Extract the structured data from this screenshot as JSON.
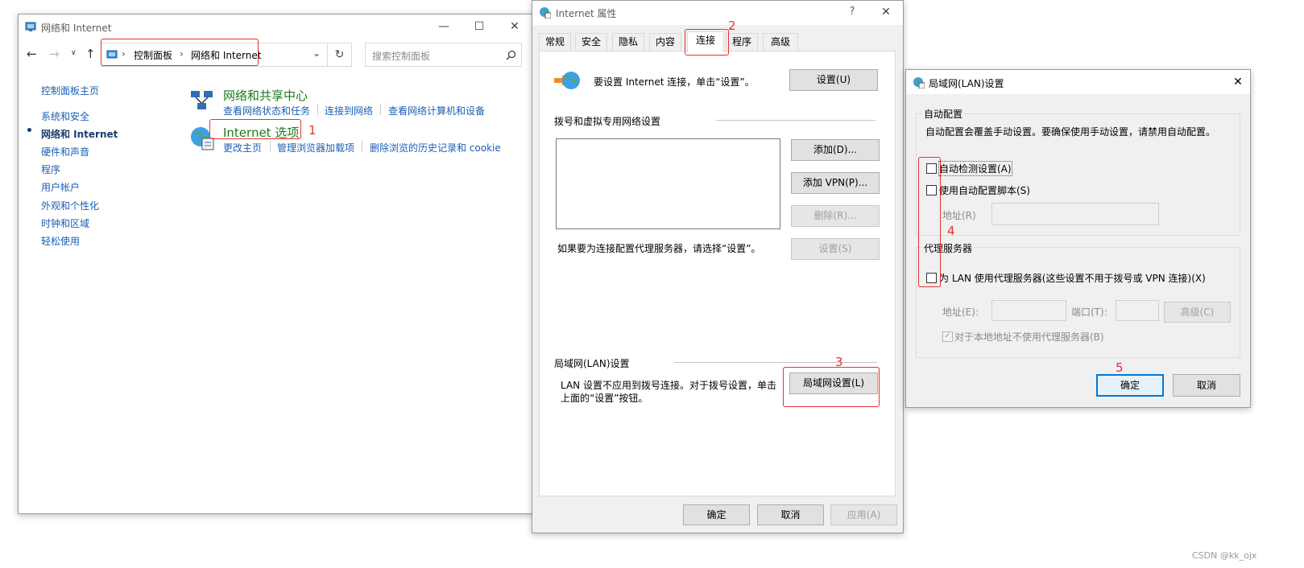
{
  "cp": {
    "title": "网络和 Internet",
    "breadcrumb": [
      "控制面板",
      "网络和 Internet"
    ],
    "search_placeholder": "搜索控制面板",
    "nav": [
      "控制面板主页",
      "系统和安全",
      "网络和 Internet",
      "硬件和声音",
      "程序",
      "用户帐户",
      "外观和个性化",
      "时钟和区域",
      "轻松使用"
    ],
    "sections": [
      {
        "title": "网络和共享中心",
        "links": [
          "查看网络状态和任务",
          "连接到网络",
          "查看网络计算机和设备"
        ]
      },
      {
        "title": "Internet 选项",
        "links": [
          "更改主页",
          "管理浏览器加载项",
          "删除浏览的历史记录和 cookie"
        ]
      }
    ]
  },
  "ip": {
    "title": "Internet 属性",
    "help": "?",
    "tabs": [
      "常规",
      "安全",
      "隐私",
      "内容",
      "连接",
      "程序",
      "高级"
    ],
    "setup_text": "要设置 Internet 连接，单击“设置”。",
    "setup_button": "设置(U)",
    "dialup_label": "拨号和虚拟专用网络设置",
    "add_button": "添加(D)...",
    "add_vpn_button": "添加 VPN(P)...",
    "remove_button": "删除(R)...",
    "settings_button": "设置(S)",
    "proxy_hint": "如果要为连接配置代理服务器，请选择“设置”。",
    "lan_label": "局域网(LAN)设置",
    "lan_text1": "LAN 设置不应用到拨号连接。对于拨号设置，单击",
    "lan_text2": "上面的“设置”按钮。",
    "lan_button": "局域网设置(L)",
    "ok": "确定",
    "cancel": "取消",
    "apply": "应用(A)"
  },
  "lan": {
    "title": "局域网(LAN)设置",
    "auto_group": "自动配置",
    "auto_desc": "自动配置会覆盖手动设置。要确保使用手动设置，请禁用自动配置。",
    "auto_detect": "自动检测设置(A)",
    "use_script": "使用自动配置脚本(S)",
    "address": "地址(R)",
    "proxy_group": "代理服务器",
    "use_proxy": "为 LAN 使用代理服务器(这些设置不用于拨号或 VPN 连接)(X)",
    "proxy_address": "地址(E):",
    "port": "端口(T):",
    "advanced": "高级(C)",
    "bypass_local": "对于本地地址不使用代理服务器(B)",
    "ok": "确定",
    "cancel": "取消"
  },
  "annotations": [
    "1",
    "2",
    "3",
    "4",
    "5"
  ],
  "watermark": "CSDN @kk_ojx",
  "colors": {
    "accent": "#0078d7",
    "annotation": "#e5322d",
    "link": "#1a5fb4",
    "green_title": "#1d7a1d"
  }
}
